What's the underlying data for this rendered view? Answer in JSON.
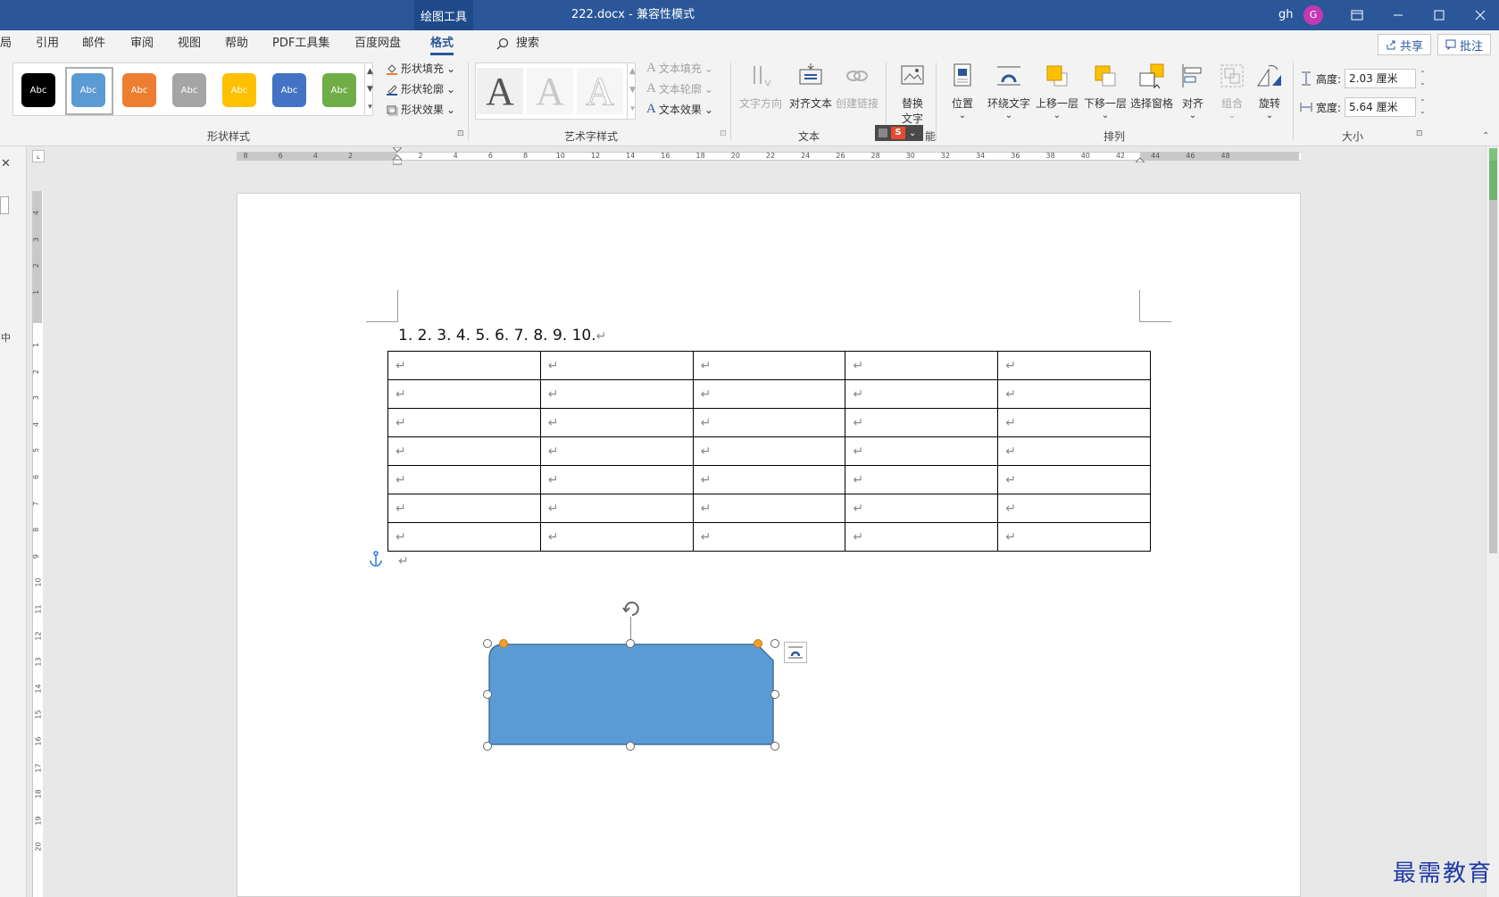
{
  "titlebar": {
    "tool_tab": "绘图工具",
    "doc_title": "222.docx  -  兼容性模式",
    "user": "gh",
    "avatar_letter": "G"
  },
  "menu": {
    "tabs": [
      "局",
      "引用",
      "邮件",
      "审阅",
      "视图",
      "帮助",
      "PDF工具集",
      "百度网盘",
      "格式"
    ],
    "active_tab": "格式",
    "search": "搜索",
    "share": "共享",
    "comment": "批注"
  },
  "ribbon": {
    "shape_styles": {
      "label": "形状样式",
      "swatch_text": "Abc",
      "swatch_colors": [
        "#000000",
        "#5b9bd5",
        "#ed7d31",
        "#a5a5a5",
        "#ffc000",
        "#4472c4",
        "#70ad47"
      ],
      "fill": "形状填充",
      "outline": "形状轮廓",
      "effects": "形状效果"
    },
    "wordart": {
      "label": "艺术字样式",
      "letter": "A",
      "text_fill": "文本填充",
      "text_outline": "文本轮廓",
      "text_effects": "文本效果"
    },
    "text": {
      "label": "文本",
      "direction": "文字方向",
      "align": "对齐文本",
      "link": "创建链接"
    },
    "alt_text": {
      "label": "替换文字",
      "line1": "替换",
      "line2": "文字",
      "group_suffix": "能"
    },
    "arrange": {
      "label": "排列",
      "position": "位置",
      "wrap": "环绕文字",
      "forward": "上移一层",
      "backward": "下移一层",
      "pane": "选择窗格",
      "align": "对齐",
      "group": "组合",
      "rotate": "旋转"
    },
    "size": {
      "label": "大小",
      "height_label": "高度:",
      "height_value": "2.03 厘米",
      "width_label": "宽度:",
      "width_value": "5.64 厘米"
    }
  },
  "ruler": {
    "h_labels": [
      "8",
      "6",
      "4",
      "2",
      "",
      "2",
      "4",
      "6",
      "8",
      "10",
      "12",
      "14",
      "16",
      "18",
      "20",
      "22",
      "24",
      "26",
      "28",
      "30",
      "32",
      "34",
      "36",
      "38",
      "40",
      "42",
      "44",
      "46",
      "48"
    ],
    "v_labels": [
      "4",
      "3",
      "2",
      "1",
      "",
      "1",
      "2",
      "3",
      "4",
      "5",
      "6",
      "7",
      "8",
      "9",
      "10",
      "11",
      "12",
      "13",
      "14",
      "15",
      "16",
      "17",
      "18",
      "19",
      "20"
    ]
  },
  "leftpane": {
    "close": "✕",
    "char": "中"
  },
  "document": {
    "numbered_line": "1. 2. 3. 4. 5. 6. 7. 8. 9. 10.",
    "para_mark": "↵",
    "table_rows": 7,
    "table_cols": 5
  },
  "shape": {
    "fill": "#5b9bd5",
    "outline": "#41719c"
  },
  "watermark": "最需教育"
}
